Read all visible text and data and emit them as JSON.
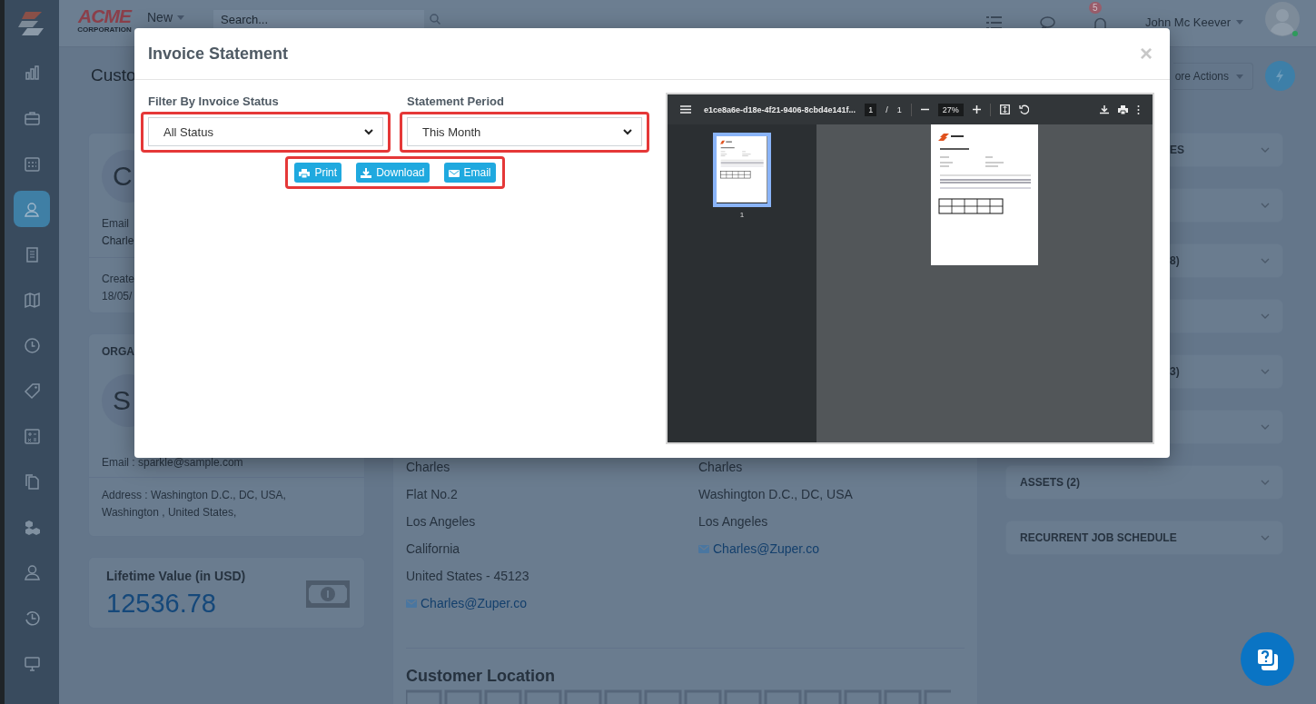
{
  "header": {
    "logo_word": "ACME",
    "logo_sub": "CORPORATION",
    "new_label": "New",
    "search_placeholder": "Search...",
    "notification_count": "5",
    "user_name": "John Mc Keever"
  },
  "sidebar": {
    "items": [
      {
        "selected": false
      },
      {
        "selected": false
      },
      {
        "selected": false
      },
      {
        "selected": true
      },
      {
        "selected": false
      },
      {
        "selected": false
      },
      {
        "selected": false
      },
      {
        "selected": false
      },
      {
        "selected": false
      },
      {
        "selected": false
      },
      {
        "selected": false
      },
      {
        "selected": false
      },
      {
        "selected": false
      },
      {
        "selected": false
      }
    ]
  },
  "page": {
    "title": "Custo",
    "more_actions": "ore Actions"
  },
  "contact_card": {
    "avatar_letter": "C",
    "email_label": "Email",
    "name": "Charle",
    "created_label": "Create",
    "created_date": "18/05/"
  },
  "organization_card": {
    "heading": "ORGA",
    "avatar_letter": "S",
    "email": "Email : sparkle@sample.com",
    "address": "Address : Washington D.C., DC, USA, Washington , United States,"
  },
  "lifetime_card": {
    "title": "Lifetime Value (in USD)",
    "value": "12536.78"
  },
  "addresses": [
    {
      "lines": [
        "Charles",
        "Flat No.2",
        "Los Angeles",
        "California",
        "United States - 45123"
      ],
      "email": "Charles@Zuper.co"
    },
    {
      "lines": [
        "Charles",
        "Washington D.C., DC, USA",
        "Los Angeles"
      ],
      "email": "Charles@Zuper.co"
    }
  ],
  "customer_location": {
    "title": "Customer Location"
  },
  "accordions": [
    {
      "label": "ES",
      "partial": true,
      "expanded": false
    },
    {
      "expanded": false
    },
    {
      "label": "8)",
      "partial": true,
      "expanded": false
    },
    {
      "expanded": false
    },
    {
      "label": "3)",
      "partial": true,
      "expanded": false
    },
    {
      "expanded": false
    },
    {
      "label": "ASSETS (2)",
      "expanded": false
    },
    {
      "label": "RECURRENT JOB SCHEDULE",
      "expanded": false
    }
  ],
  "modal": {
    "title": "Invoice Statement",
    "close": "×",
    "filters": [
      {
        "label": "Filter By Invoice Status",
        "value": "All Status"
      },
      {
        "label": "Statement Period",
        "value": "This Month"
      }
    ],
    "actions": [
      {
        "label": "Print"
      },
      {
        "label": "Download"
      },
      {
        "label": "Email"
      }
    ],
    "pdf_viewer": {
      "file_name": "e1ce8a6e-d18e-4f21-9406-8cbd4e141f...",
      "page": "1",
      "page_divider": "/",
      "page_count": "1",
      "zoom": "27%",
      "thumbnails": [
        {
          "label": "1",
          "selected": true
        }
      ]
    }
  }
}
